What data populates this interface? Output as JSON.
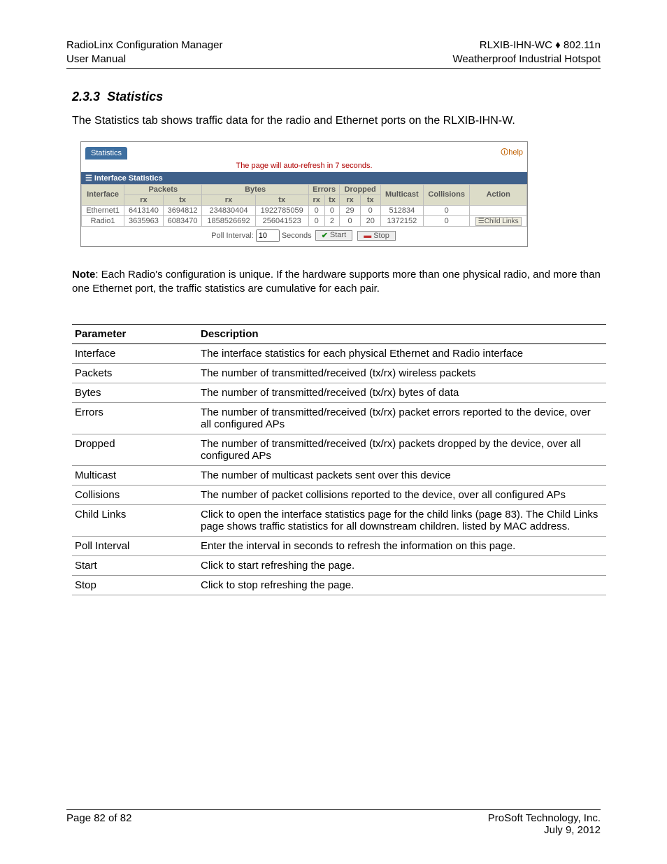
{
  "header": {
    "left1": "RadioLinx Configuration Manager",
    "left2": "User Manual",
    "right1": "RLXIB-IHN-WC ♦ 802.11n",
    "right2": "Weatherproof Industrial Hotspot"
  },
  "section": {
    "number": "2.3.3",
    "title": "Statistics",
    "intro": "The Statistics tab shows traffic data for the radio and Ethernet ports on the RLXIB-IHN-W."
  },
  "shot": {
    "tab": "Statistics",
    "help": "help",
    "refresh": "The page will auto-refresh in 7 seconds.",
    "panel": "Interface Statistics",
    "headers": {
      "interface": "Interface",
      "packets": "Packets",
      "bytes": "Bytes",
      "errors": "Errors",
      "dropped": "Dropped",
      "multicast": "Multicast",
      "collisions": "Collisions",
      "action": "Action",
      "rx": "rx",
      "tx": "tx"
    },
    "rows": [
      {
        "iface": "Ethernet1",
        "prx": "6413140",
        "ptx": "3694812",
        "brx": "234830404",
        "btx": "1922785059",
        "erx": "0",
        "etx": "0",
        "drx": "29",
        "dtx": "0",
        "mcast": "512834",
        "coll": "0",
        "action": ""
      },
      {
        "iface": "Radio1",
        "prx": "3635963",
        "ptx": "6083470",
        "brx": "1858526692",
        "btx": "256041523",
        "erx": "0",
        "etx": "2",
        "drx": "0",
        "dtx": "20",
        "mcast": "1372152",
        "coll": "0",
        "action": "Child Links"
      }
    ],
    "poll_label": "Poll Interval:",
    "poll_val": "10",
    "seconds": "Seconds",
    "start": "Start",
    "stop": "Stop"
  },
  "note": {
    "label": "Note",
    "text": ": Each Radio's configuration is unique. If the hardware supports more than one physical radio, and more than one Ethernet port, the traffic statistics are cumulative for each pair."
  },
  "params": {
    "h1": "Parameter",
    "h2": "Description",
    "rows": [
      {
        "p": "Interface",
        "d": "The interface statistics for each physical Ethernet and Radio interface"
      },
      {
        "p": "Packets",
        "d": "The number of transmitted/received (tx/rx) wireless packets"
      },
      {
        "p": "Bytes",
        "d": "The number of transmitted/received (tx/rx) bytes of data"
      },
      {
        "p": "Errors",
        "d": "The number of transmitted/received (tx/rx) packet errors reported to the device, over all configured APs"
      },
      {
        "p": "Dropped",
        "d": "The number of transmitted/received (tx/rx) packets dropped by the device, over all configured APs"
      },
      {
        "p": "Multicast",
        "d": "The number of multicast packets sent over this device"
      },
      {
        "p": "Collisions",
        "d": "The number of packet collisions reported to the device, over all configured APs"
      },
      {
        "p": "Child Links",
        "d": "Click to open the interface statistics page for the child links (page 83). The Child Links page shows traffic statistics for all downstream children. listed by MAC address."
      },
      {
        "p": "Poll Interval",
        "d": "Enter the interval in seconds to refresh the information on this page."
      },
      {
        "p": "Start",
        "d": "Click to start refreshing the page."
      },
      {
        "p": "Stop",
        "d": "Click to stop refreshing the page."
      }
    ]
  },
  "footer": {
    "left": "Page 82 of 82",
    "right1": "ProSoft Technology, Inc.",
    "right2": "July 9, 2012"
  }
}
